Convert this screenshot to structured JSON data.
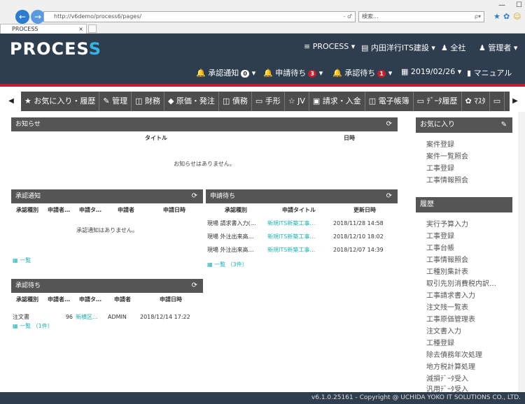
{
  "browser": {
    "url": "http://v6demo/process6/pages/",
    "search_placeholder": "検索...",
    "tab_title": "PROCESS",
    "tab_close": "×",
    "back": "←",
    "forward": "→",
    "addr_controls": "- ♂",
    "search_icon": "ρ▾",
    "min": "—",
    "max": "☐",
    "close": "✕",
    "icons": [
      "★",
      "✿",
      "☺"
    ]
  },
  "app": {
    "logo_main": "PROCES",
    "logo_end": "S",
    "header_row1": [
      {
        "icon": "≡",
        "label": "PROCESS ▾"
      },
      {
        "icon": "▤",
        "label": "内田洋行ITS建設 ▾"
      },
      {
        "icon": "♟",
        "label": "全社"
      },
      {
        "icon": "♟",
        "label": "管理者 ▾"
      }
    ],
    "header_row2": {
      "approval_notice": "承認通知",
      "approval_notice_count": "0",
      "requesting": "申請待ち",
      "requesting_count": "3",
      "approval_wait": "承認待ち",
      "approval_wait_count": "1",
      "date": "2019/02/26 ▾",
      "manual": "マニュアル"
    },
    "colors": {
      "header": "#2f3e4f",
      "accent_red": "#c21e2b",
      "link": "#1fb3b3",
      "logo_accent": "#34b5e5"
    }
  },
  "menu": {
    "items": [
      "★ お気に入り・履歴",
      "✎ 管理",
      "◫ 財務",
      "◆ 原価・発注",
      "◫ 債務",
      "▭ 手形",
      "☆ JV",
      "▣ 請求・入金",
      "◫ 電子帳簿",
      "▭ ﾃﾞｰﾀ履歴",
      "✿ ﾏｽﾀ",
      "▭"
    ],
    "left": "◀",
    "right": "▶"
  },
  "notice": {
    "title": "お知らせ",
    "refresh": "⟳",
    "cols": [
      "タイトル",
      "日時"
    ],
    "empty": "お知らせはありません。"
  },
  "approval_notice": {
    "title": "承認通知",
    "refresh": "⟳",
    "cols": [
      "承認種別",
      "申請者…",
      "申請タ…",
      "申請者",
      "申請日時"
    ],
    "empty": "承認通知はありません。",
    "more": "▦ 一覧"
  },
  "requesting": {
    "title": "申請待ち",
    "refresh": "⟳",
    "cols": [
      "承認種別",
      "申請タイトル",
      "更新日時"
    ],
    "rows": [
      [
        "現場 請求書入力(…",
        "新規ITS新築工事…",
        "2018/11/28 14:58"
      ],
      [
        "現場 外注出来高…",
        "新規ITS新築工事…",
        "2018/12/10 18:02"
      ],
      [
        "現場 外注出来高…",
        "新規ITS新築工事…",
        "2018/12/07 14:39"
      ]
    ],
    "more": "▦ 一覧 （3件）"
  },
  "approval_wait": {
    "title": "承認待ち",
    "refresh": "⟳",
    "cols": [
      "承認種別",
      "申請者…",
      "申請タ…",
      "申請者",
      "申請日時"
    ],
    "rows": [
      [
        "注文書",
        "96",
        "新横区…",
        "ADMIN",
        "2018/12/14 17:22"
      ]
    ],
    "more": "▦ 一覧 （1件）"
  },
  "favorites": {
    "title": "お気に入り",
    "edit": "✎",
    "items": [
      "案件登録",
      "案件一覧照会",
      "工事登録",
      "工事情報照会"
    ]
  },
  "history": {
    "title": "履歴",
    "items": [
      "実行予算入力",
      "工事登録",
      "工事台帳",
      "工事情報照会",
      "工種別集計表",
      "取引先別消費税内訳…",
      "工事請求書入力",
      "注文残一覧表",
      "工事原価管理表",
      "注文書入力",
      "工種登録",
      "除去債務年次処理",
      "地方税計算処理",
      "減損ﾃﾞｰﾀ受入",
      "汎用ﾃﾞｰﾀ受入"
    ]
  },
  "footer": "v6.1.0.25161 - Copyright @ UCHIDA YOKO IT SOLUTIONS CO., LTD."
}
